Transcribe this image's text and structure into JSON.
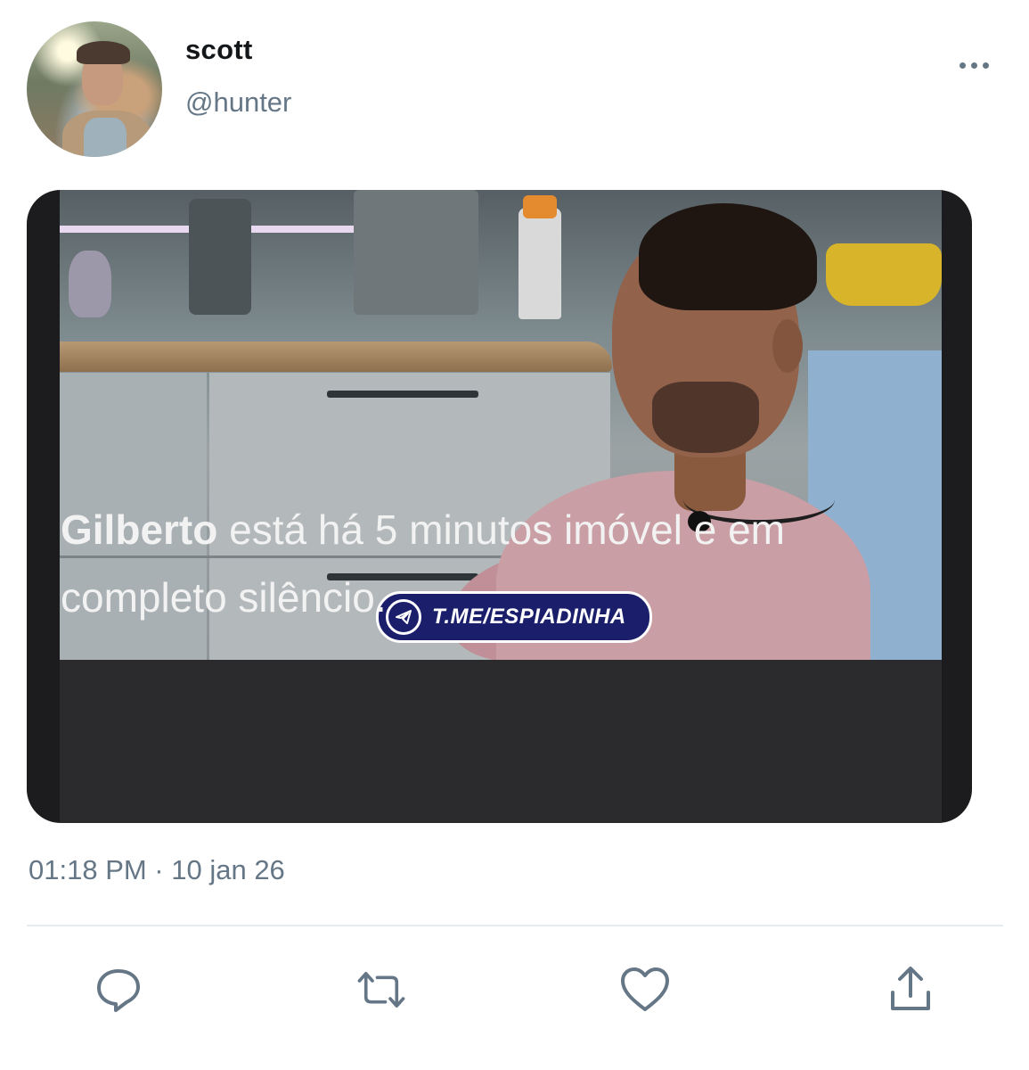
{
  "author": {
    "display_name": "scott",
    "handle": "@hunter",
    "avatar_icon": "profile-photo"
  },
  "menu_icon": "more-options-icon",
  "media": {
    "watermark_text": "T.ME/ESPIADINHA",
    "watermark_icon": "telegram-icon",
    "caption_name": "Gilberto",
    "caption_rest": " está há 5 minutos imóvel e em completo silêncio."
  },
  "timestamp": "01:18 PM · 10 jan 26",
  "actions": [
    {
      "name": "reply",
      "icon": "speech-bubble-icon"
    },
    {
      "name": "retweet",
      "icon": "retweet-arrows-icon"
    },
    {
      "name": "like",
      "icon": "heart-icon"
    },
    {
      "name": "share",
      "icon": "share-upload-icon"
    }
  ],
  "colors": {
    "text_primary": "#14171a",
    "text_secondary": "#657786",
    "divider": "#e6ecf0"
  }
}
